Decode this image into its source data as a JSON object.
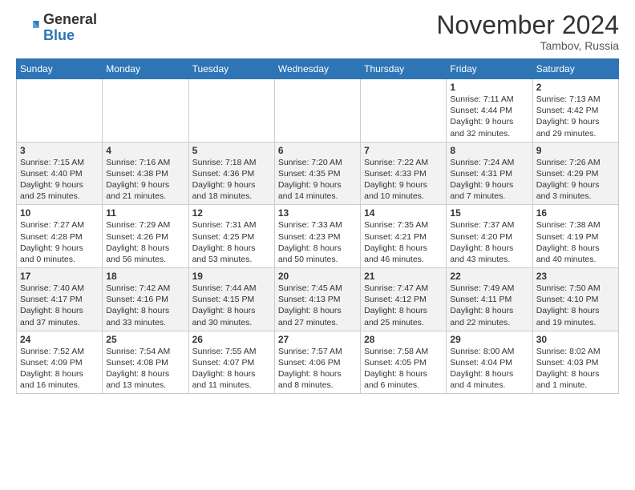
{
  "header": {
    "logo_general": "General",
    "logo_blue": "Blue",
    "month_title": "November 2024",
    "location": "Tambov, Russia"
  },
  "days_of_week": [
    "Sunday",
    "Monday",
    "Tuesday",
    "Wednesday",
    "Thursday",
    "Friday",
    "Saturday"
  ],
  "weeks": [
    {
      "row_bg": "odd",
      "days": [
        {
          "num": "",
          "info": ""
        },
        {
          "num": "",
          "info": ""
        },
        {
          "num": "",
          "info": ""
        },
        {
          "num": "",
          "info": ""
        },
        {
          "num": "",
          "info": ""
        },
        {
          "num": "1",
          "info": "Sunrise: 7:11 AM\nSunset: 4:44 PM\nDaylight: 9 hours\nand 32 minutes."
        },
        {
          "num": "2",
          "info": "Sunrise: 7:13 AM\nSunset: 4:42 PM\nDaylight: 9 hours\nand 29 minutes."
        }
      ]
    },
    {
      "row_bg": "even",
      "days": [
        {
          "num": "3",
          "info": "Sunrise: 7:15 AM\nSunset: 4:40 PM\nDaylight: 9 hours\nand 25 minutes."
        },
        {
          "num": "4",
          "info": "Sunrise: 7:16 AM\nSunset: 4:38 PM\nDaylight: 9 hours\nand 21 minutes."
        },
        {
          "num": "5",
          "info": "Sunrise: 7:18 AM\nSunset: 4:36 PM\nDaylight: 9 hours\nand 18 minutes."
        },
        {
          "num": "6",
          "info": "Sunrise: 7:20 AM\nSunset: 4:35 PM\nDaylight: 9 hours\nand 14 minutes."
        },
        {
          "num": "7",
          "info": "Sunrise: 7:22 AM\nSunset: 4:33 PM\nDaylight: 9 hours\nand 10 minutes."
        },
        {
          "num": "8",
          "info": "Sunrise: 7:24 AM\nSunset: 4:31 PM\nDaylight: 9 hours\nand 7 minutes."
        },
        {
          "num": "9",
          "info": "Sunrise: 7:26 AM\nSunset: 4:29 PM\nDaylight: 9 hours\nand 3 minutes."
        }
      ]
    },
    {
      "row_bg": "odd",
      "days": [
        {
          "num": "10",
          "info": "Sunrise: 7:27 AM\nSunset: 4:28 PM\nDaylight: 9 hours\nand 0 minutes."
        },
        {
          "num": "11",
          "info": "Sunrise: 7:29 AM\nSunset: 4:26 PM\nDaylight: 8 hours\nand 56 minutes."
        },
        {
          "num": "12",
          "info": "Sunrise: 7:31 AM\nSunset: 4:25 PM\nDaylight: 8 hours\nand 53 minutes."
        },
        {
          "num": "13",
          "info": "Sunrise: 7:33 AM\nSunset: 4:23 PM\nDaylight: 8 hours\nand 50 minutes."
        },
        {
          "num": "14",
          "info": "Sunrise: 7:35 AM\nSunset: 4:21 PM\nDaylight: 8 hours\nand 46 minutes."
        },
        {
          "num": "15",
          "info": "Sunrise: 7:37 AM\nSunset: 4:20 PM\nDaylight: 8 hours\nand 43 minutes."
        },
        {
          "num": "16",
          "info": "Sunrise: 7:38 AM\nSunset: 4:19 PM\nDaylight: 8 hours\nand 40 minutes."
        }
      ]
    },
    {
      "row_bg": "even",
      "days": [
        {
          "num": "17",
          "info": "Sunrise: 7:40 AM\nSunset: 4:17 PM\nDaylight: 8 hours\nand 37 minutes."
        },
        {
          "num": "18",
          "info": "Sunrise: 7:42 AM\nSunset: 4:16 PM\nDaylight: 8 hours\nand 33 minutes."
        },
        {
          "num": "19",
          "info": "Sunrise: 7:44 AM\nSunset: 4:15 PM\nDaylight: 8 hours\nand 30 minutes."
        },
        {
          "num": "20",
          "info": "Sunrise: 7:45 AM\nSunset: 4:13 PM\nDaylight: 8 hours\nand 27 minutes."
        },
        {
          "num": "21",
          "info": "Sunrise: 7:47 AM\nSunset: 4:12 PM\nDaylight: 8 hours\nand 25 minutes."
        },
        {
          "num": "22",
          "info": "Sunrise: 7:49 AM\nSunset: 4:11 PM\nDaylight: 8 hours\nand 22 minutes."
        },
        {
          "num": "23",
          "info": "Sunrise: 7:50 AM\nSunset: 4:10 PM\nDaylight: 8 hours\nand 19 minutes."
        }
      ]
    },
    {
      "row_bg": "odd",
      "days": [
        {
          "num": "24",
          "info": "Sunrise: 7:52 AM\nSunset: 4:09 PM\nDaylight: 8 hours\nand 16 minutes."
        },
        {
          "num": "25",
          "info": "Sunrise: 7:54 AM\nSunset: 4:08 PM\nDaylight: 8 hours\nand 13 minutes."
        },
        {
          "num": "26",
          "info": "Sunrise: 7:55 AM\nSunset: 4:07 PM\nDaylight: 8 hours\nand 11 minutes."
        },
        {
          "num": "27",
          "info": "Sunrise: 7:57 AM\nSunset: 4:06 PM\nDaylight: 8 hours\nand 8 minutes."
        },
        {
          "num": "28",
          "info": "Sunrise: 7:58 AM\nSunset: 4:05 PM\nDaylight: 8 hours\nand 6 minutes."
        },
        {
          "num": "29",
          "info": "Sunrise: 8:00 AM\nSunset: 4:04 PM\nDaylight: 8 hours\nand 4 minutes."
        },
        {
          "num": "30",
          "info": "Sunrise: 8:02 AM\nSunset: 4:03 PM\nDaylight: 8 hours\nand 1 minute."
        }
      ]
    }
  ]
}
